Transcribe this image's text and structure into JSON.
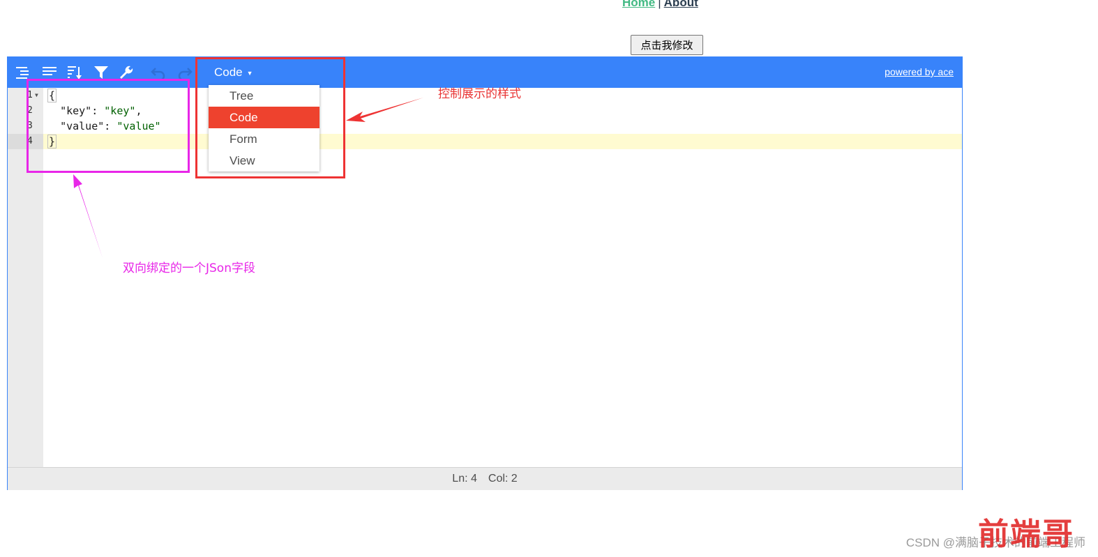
{
  "nav": {
    "home": "Home",
    "separator": "|",
    "about": "About"
  },
  "modify_button": "点击我修改",
  "editor": {
    "mode_label": "Code",
    "powered_by": "powered by ace",
    "line_numbers": [
      "1",
      "2",
      "3",
      "4"
    ],
    "lines": [
      [
        "{"
      ],
      [
        "  ",
        "\"key\"",
        ": ",
        "\"key\"",
        ","
      ],
      [
        "  ",
        "\"value\"",
        ": ",
        "\"value\""
      ],
      [
        "}"
      ]
    ],
    "active_line": 4,
    "status": {
      "ln": "Ln: 4",
      "col": "Col: 2"
    },
    "toolbar_icons": [
      "format-icon",
      "compact-icon",
      "sort-icon",
      "filter-icon",
      "repair-icon",
      "undo-icon",
      "redo-icon"
    ]
  },
  "dropdown": {
    "items": [
      "Tree",
      "Code",
      "Form",
      "View"
    ],
    "selected": "Code"
  },
  "annotations": {
    "mode_note": "控制展示的样式",
    "json_note": "双向绑定的一个JSon字段"
  },
  "colors": {
    "accent": "#3883fa",
    "selected": "#ee422e",
    "annotation_red": "#e83232",
    "annotation_magenta": "#e826e8"
  },
  "watermark": "CSDN @满脑子技术的前端工程师",
  "brand": "前端哥"
}
